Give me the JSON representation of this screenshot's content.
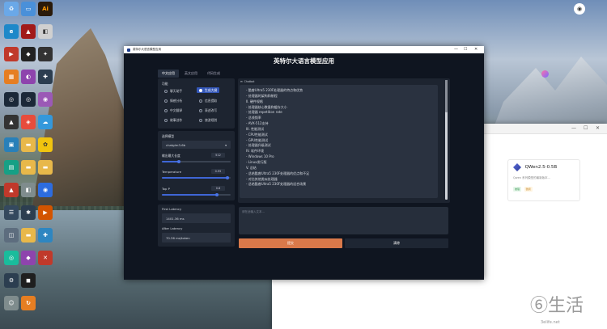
{
  "app": {
    "window_title": "英特尔大语言模型应用",
    "heading": "英特尔大语言模型应用",
    "tabs": [
      {
        "label": "中文应用",
        "active": true
      },
      {
        "label": "英文应用",
        "active": false
      },
      {
        "label": "代码生成",
        "active": false
      }
    ],
    "function": {
      "label": "功能",
      "options": [
        {
          "label": "聊天助手",
          "selected": false
        },
        {
          "label": "生成大纲",
          "selected": true
        },
        {
          "label": "情感分析",
          "selected": false
        },
        {
          "label": "信息提取",
          "selected": false
        },
        {
          "label": "中文翻译",
          "selected": false
        },
        {
          "label": "表述改写",
          "selected": false
        },
        {
          "label": "故事创作",
          "selected": false
        },
        {
          "label": "旅游规划",
          "selected": false
        }
      ]
    },
    "model": {
      "label": "选择模型",
      "value": "chatglm3-6b"
    },
    "params": {
      "max_length": {
        "label": "输出最大长度",
        "value": "512",
        "fraction": 0.25
      },
      "temperature": {
        "label": "Temperature",
        "value": "0.95",
        "fraction": 0.95
      },
      "top_p": {
        "label": "Top P",
        "value": "0.8",
        "fraction": 0.8
      }
    },
    "first_latency": {
      "label": "First Latency",
      "value": "1401.36 ms"
    },
    "after_latency": {
      "label": "After Latency",
      "value": "70.36 ms/token"
    },
    "chatbot": {
      "label": "Chatbot",
      "lines": [
        "- 酷睿Ultra5 230F处理器的特点和优势",
        "- 处理器的架构和制程",
        "II. 硬件规格",
        "- 处理器核心数量和缓存大小",
        "- 处理器 repetition rate",
        "- 总线频率",
        "- AVX-512支持",
        "III. 性能测试",
        "- CPU性能测试",
        "- GPU性能测试",
        "- 处理器升级测试",
        "IV. 软件环境",
        "- Windows 10 Pro",
        "- Linux发行版",
        "V. 总结",
        "- 总结酷睿Ultra5 230F处理器的优点和不足",
        "- 对比其他类似处理器",
        "- 总结酷睿Ultra5 230F处理器的适合场景"
      ]
    },
    "input": {
      "placeholder": "请在此输入文本…"
    },
    "buttons": {
      "submit": "提交",
      "clear": "清除"
    }
  },
  "desktop": {
    "tray_label": "",
    "icons": [
      {
        "name": "recycle-bin",
        "color": "#6aa8e8",
        "glyph": "♻"
      },
      {
        "name": "display",
        "color": "#4a90d9",
        "glyph": "▭"
      },
      {
        "name": "adobe-illustrator",
        "color": "#2a1a0a",
        "glyph": "Ai"
      }
    ]
  },
  "browser": {
    "card_title": "QWen2.5-0.5B",
    "card_desc": "Qwen 系列模型的最新版本...",
    "tag1": "推理",
    "tag2": "微调"
  },
  "watermark": {
    "brand": "⑥生活",
    "url": "3elife.net"
  }
}
